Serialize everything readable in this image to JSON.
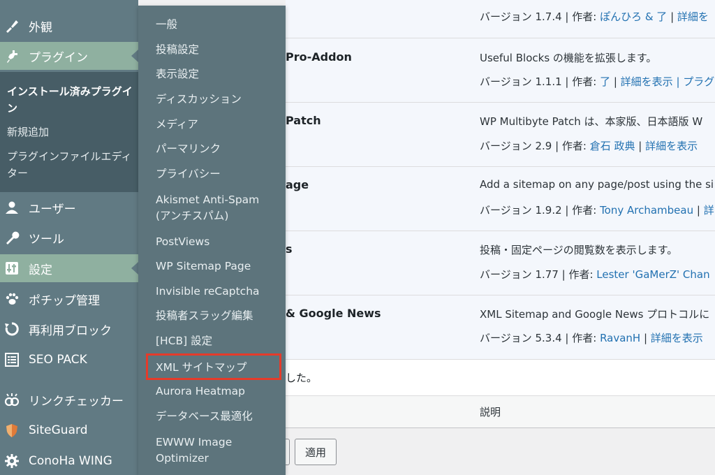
{
  "sidebar": {
    "items": [
      {
        "label": "外観",
        "icon": "paintbrush-icon"
      },
      {
        "label": "プラグイン",
        "icon": "plugin-icon"
      },
      {
        "label": "ユーザー",
        "icon": "user-icon"
      },
      {
        "label": "ツール",
        "icon": "wrench-icon"
      },
      {
        "label": "設定",
        "icon": "settings-icon"
      },
      {
        "label": "ポチップ管理",
        "icon": "paw-icon"
      },
      {
        "label": "再利用ブロック",
        "icon": "reuse-icon"
      },
      {
        "label": "SEO PACK",
        "icon": "list-icon"
      },
      {
        "label": "リンクチェッカー",
        "icon": "link-checker-icon"
      },
      {
        "label": "SiteGuard",
        "icon": "shield-icon"
      },
      {
        "label": "ConoHa WING",
        "icon": "gear-icon"
      }
    ],
    "plugin_submenu": {
      "installed": "インストール済みプラグイン",
      "add_new": "新規追加",
      "editor": "プラグインファイルエディター"
    }
  },
  "flyout": {
    "items": [
      "一般",
      "投稿設定",
      "表示設定",
      "ディスカッション",
      "メディア",
      "パーマリンク",
      "プライバシー",
      "Akismet Anti-Spam (アンチスパム)",
      "PostViews",
      "WP Sitemap Page",
      "Invisible reCaptcha",
      "投稿者スラッグ編集",
      "[HCB] 設定",
      "XML サイトマップ",
      "Aurora Heatmap",
      "データベース最適化",
      "EWWW Image Optimizer"
    ]
  },
  "plugins": [
    {
      "name": "",
      "description": "",
      "version_label": "バージョン 1.7.4 | 作者: ",
      "author": "ぽんひろ & 了",
      "sep": " | ",
      "details": "詳細を"
    },
    {
      "name": "Pro-Addon",
      "description": "Useful Blocks の機能を拡張します。",
      "version_label": "バージョン 1.1.1 | 作者: ",
      "author": "了",
      "sep": " | ",
      "details": "詳細を表示",
      "extra": " | プラグ"
    },
    {
      "name": "Patch",
      "description": "WP Multibyte Patch は、本家版、日本語版 W",
      "version_label": "バージョン 2.9 | 作者: ",
      "author": "倉石 政典",
      "sep": " | ",
      "details": "詳細を表示"
    },
    {
      "name": "age",
      "description": "Add a sitemap on any page/post using the si",
      "version_label": "バージョン 1.9.2 | 作者: ",
      "author": "Tony Archambeau",
      "sep": " | ",
      "details": "詳"
    },
    {
      "name": "s",
      "description": "投稿・固定ページの閲覧数を表示します。",
      "version_label": "バージョン 1.77 | 作者: ",
      "author": "Lester 'GaMerZ' Chan",
      "sep": "",
      "details": ""
    },
    {
      "name": "& Google News",
      "description": "XML Sitemap and Google News プロトコルに",
      "version_label": "バージョン 5.3.4 | 作者: ",
      "author": "RavanH",
      "sep": " | ",
      "details": "詳細を表示"
    }
  ],
  "notice": "した。",
  "table_footer": {
    "description_header": "説明"
  },
  "bulk": {
    "apply_label": "適用"
  }
}
